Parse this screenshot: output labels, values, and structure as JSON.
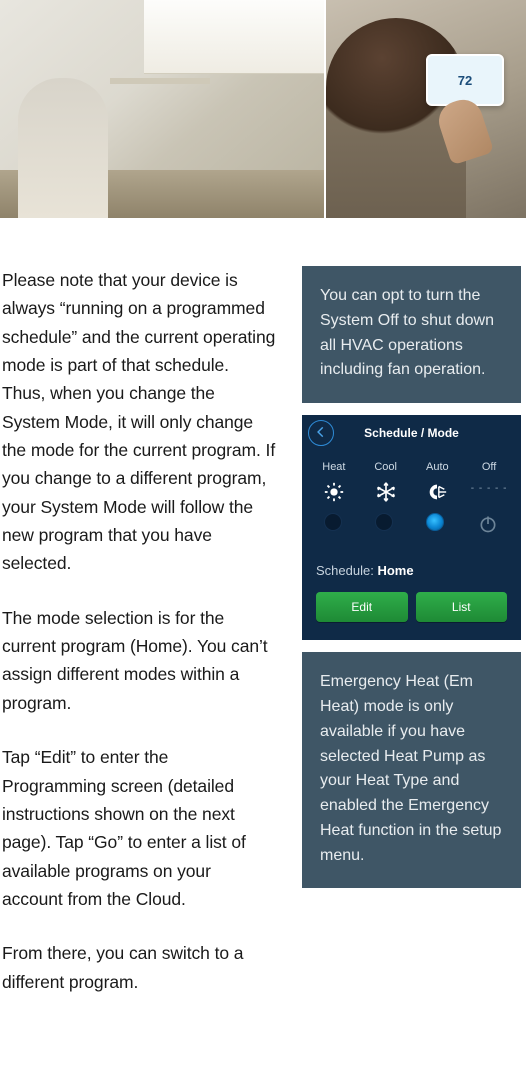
{
  "hero": {
    "thermostat_reading": "72"
  },
  "body": {
    "p1": "Please note that your device is always “running on a programmed schedule” and the current operating mode is part of that schedule. Thus, when you change the System Mode, it will only change the mode for the current program. If you change to a different program, your System Mode will follow the new program that you have selected.",
    "p2": "The mode selection is for the current program (Home). You can’t assign different modes within a program.",
    "p3": "Tap “Edit” to enter the Programming screen (detailed instructions shown on the next page). Tap “Go” to enter a list of available programs on your account from the Cloud.",
    "p4": "From there, you can switch to a different program."
  },
  "notes": {
    "system_off": "You can opt to turn the System Off to shut down all HVAC operations including fan operation.",
    "em_heat": "Emergency Heat (Em Heat) mode is only available if you have selected Heat Pump as your Heat Type and enabled the Emergency Heat function in the setup menu."
  },
  "device": {
    "title": "Schedule / Mode",
    "modes": {
      "heat": "Heat",
      "cool": "Cool",
      "auto": "Auto",
      "off": "Off"
    },
    "off_placeholder": "- - - - -",
    "schedule_label": "Schedule:",
    "schedule_value": "Home",
    "edit": "Edit",
    "list": "List"
  }
}
